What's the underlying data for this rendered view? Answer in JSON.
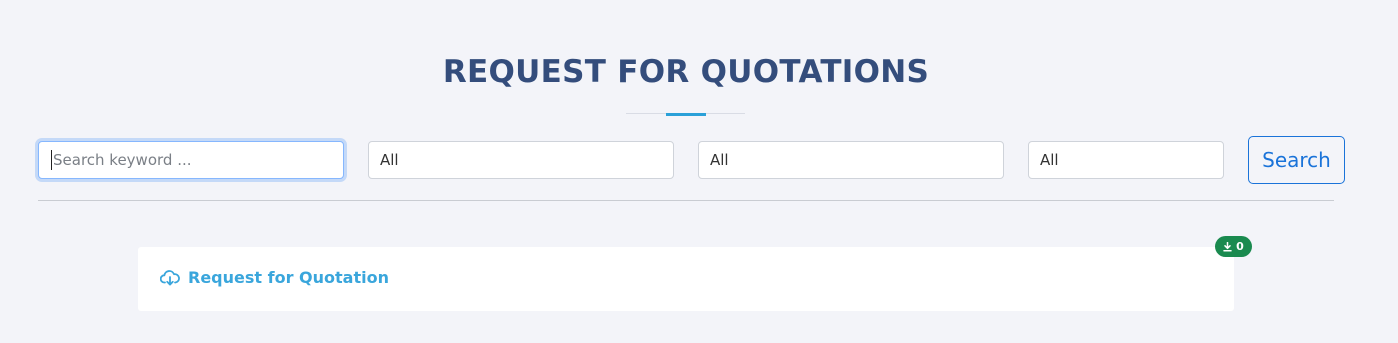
{
  "header": {
    "title": "REQUEST FOR QUOTATIONS"
  },
  "filters": {
    "search_placeholder": "Search keyword ...",
    "select_1": "All",
    "select_2": "All",
    "select_3": "All",
    "search_button": "Search"
  },
  "result": {
    "link_label": "Request for Quotation",
    "link_icon": "cloud-download-icon",
    "download_count": "0",
    "badge_icon": "download-icon",
    "badge_color": "#1a8a4f"
  },
  "colors": {
    "title": "#344d7c",
    "accent": "#2aa0d8",
    "link": "#3aa6dc",
    "button": "#1a73d9",
    "background": "#f3f4f9"
  }
}
